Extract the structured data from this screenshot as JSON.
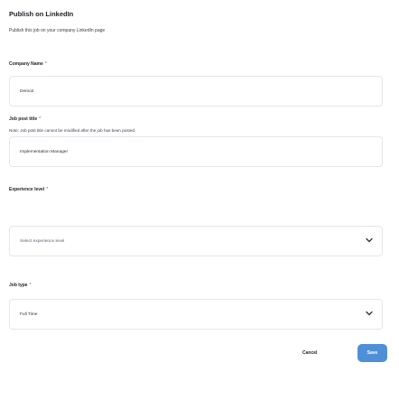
{
  "header": {
    "title": "Publish on LinkedIn",
    "subtitle": "Publish this job on your company LinkedIn page"
  },
  "form": {
    "required_marker": "*",
    "company_name": {
      "label": "Company Name",
      "value": "Demo2"
    },
    "job_post_title": {
      "label": "Job post title",
      "note": "Note: Job post title cannot be modified after the job has been posted.",
      "value": "Implementation Manager"
    },
    "experience_level": {
      "label": "Experience level",
      "placeholder": "Select experience level"
    },
    "job_type": {
      "label": "Job type",
      "value": "Full Time"
    }
  },
  "footer": {
    "cancel_label": "Cancel",
    "save_label": "Save"
  },
  "icons": {
    "dropdown": "chevron-down-icon"
  }
}
